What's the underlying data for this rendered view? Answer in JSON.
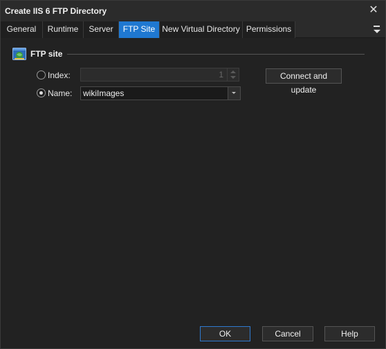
{
  "window": {
    "title": "Create IIS 6 FTP Directory",
    "close_glyph": "✕"
  },
  "tabs": [
    {
      "label": "General",
      "active": false
    },
    {
      "label": "Runtime",
      "active": false
    },
    {
      "label": "Server",
      "active": false
    },
    {
      "label": "FTP Site",
      "active": true
    },
    {
      "label": "New Virtual Directory",
      "active": false
    },
    {
      "label": "Permissions",
      "active": false
    }
  ],
  "group": {
    "title": "FTP site",
    "icon": "ftp-site-icon"
  },
  "index": {
    "label": "Index:",
    "value": "1",
    "selected": false
  },
  "name": {
    "label": "Name:",
    "value": "wikiImages",
    "selected": true
  },
  "buttons": {
    "connect_update": "Connect and update",
    "ok": "OK",
    "cancel": "Cancel",
    "help": "Help"
  },
  "colors": {
    "accent": "#1f78d1",
    "background": "#222222"
  }
}
